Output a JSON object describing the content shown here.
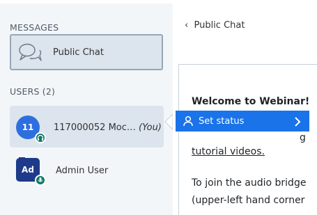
{
  "sidebar": {
    "messages_heading": "MESSAGES",
    "public_chat_label": "Public Chat",
    "users_heading": "USERS (2)",
    "users": [
      {
        "avatar_text": "11",
        "name": "117000052 Moc…",
        "you_label": "(You)",
        "badge": "headphones-icon"
      },
      {
        "avatar_text": "Ad",
        "name": "Admin User",
        "badge": "microphone-icon"
      }
    ]
  },
  "status_menu": {
    "label": "Set status"
  },
  "chat": {
    "header": "Public Chat",
    "back_glyph": "‹",
    "lines": [
      "Welcome to Webinar!",
      "tutorial videos.",
      "To join the audio bridge",
      "(upper-left hand corner"
    ],
    "peek_char": "g"
  },
  "colors": {
    "sidebar_bg": "#f3f6f9",
    "active_bg": "#dce4ed",
    "accent_blue": "#1a73e8",
    "avatar_blue": "#2e6fe0",
    "admin_avatar": "#1e3a8a",
    "badge_teal": "#0f7a6a"
  }
}
